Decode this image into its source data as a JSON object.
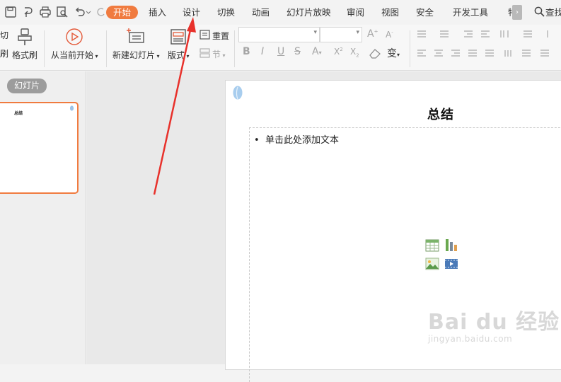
{
  "menu": {
    "tabs": [
      "开始",
      "插入",
      "设计",
      "切换",
      "动画",
      "幻灯片放映",
      "审阅",
      "视图",
      "安全",
      "开发工具",
      "特"
    ],
    "search_label": "查找"
  },
  "ribbon": {
    "cut_label": "切",
    "brush_partial": "刷",
    "format_painter": "格式刷",
    "play_from_current": "从当前开始",
    "new_slide": "新建幻灯片",
    "layout": "版式",
    "reset": "重置",
    "section": "节"
  },
  "left_panel": {
    "tag": "幻灯片",
    "thumb_title": "总结"
  },
  "slide": {
    "title": "总结",
    "placeholder": "单击此处添加文本"
  },
  "watermark": {
    "brand": "Bai du 经验",
    "url": "jingyan.baidu.com"
  },
  "colors": {
    "accent": "#f07b3f",
    "arrow": "#e8312b"
  }
}
